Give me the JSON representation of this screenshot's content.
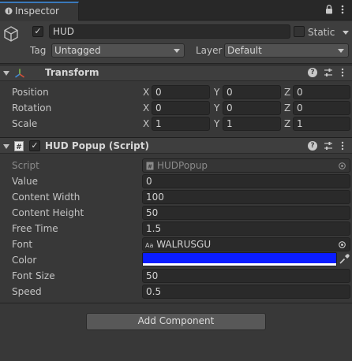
{
  "window": {
    "tab_label": "Inspector"
  },
  "gameobject": {
    "name": "HUD",
    "active": true,
    "static_label": "Static",
    "static_checked": false,
    "tag_label": "Tag",
    "tag_value": "Untagged",
    "layer_label": "Layer",
    "layer_value": "Default"
  },
  "transform": {
    "title": "Transform",
    "rows": [
      {
        "label": "Position",
        "x": "0",
        "y": "0",
        "z": "0"
      },
      {
        "label": "Rotation",
        "x": "0",
        "y": "0",
        "z": "0"
      },
      {
        "label": "Scale",
        "x": "1",
        "y": "1",
        "z": "1"
      }
    ],
    "axes": {
      "x": "X",
      "y": "Y",
      "z": "Z"
    }
  },
  "script_component": {
    "title": "HUD Popup (Script)",
    "enabled": true,
    "script_label": "Script",
    "script_value": "HUDPopup",
    "fields": [
      {
        "label": "Value",
        "value": "0"
      },
      {
        "label": "Content Width",
        "value": "100"
      },
      {
        "label": "Content Height",
        "value": "50"
      },
      {
        "label": "Free Time",
        "value": "1.5"
      }
    ],
    "font_label": "Font",
    "font_value": "WALRUSGU",
    "font_prefix": "Aa",
    "color_label": "Color",
    "color_value": "#0a1cff",
    "fields2": [
      {
        "label": "Font Size",
        "value": "50"
      },
      {
        "label": "Speed",
        "value": "0.5"
      }
    ]
  },
  "footer": {
    "add_component_label": "Add Component"
  },
  "icons": {
    "tab": "info-icon",
    "lock": "lock-icon",
    "menu": "kebab-menu-icon",
    "gameobject": "cube-icon",
    "transform": "transform-axes-icon",
    "script": "script-icon",
    "help": "help-icon",
    "presets": "presets-icon",
    "object_picker": "object-picker-icon",
    "eyedropper": "eyedropper-icon",
    "font_asset": "font-asset-icon",
    "script_asset": "script-asset-icon"
  }
}
